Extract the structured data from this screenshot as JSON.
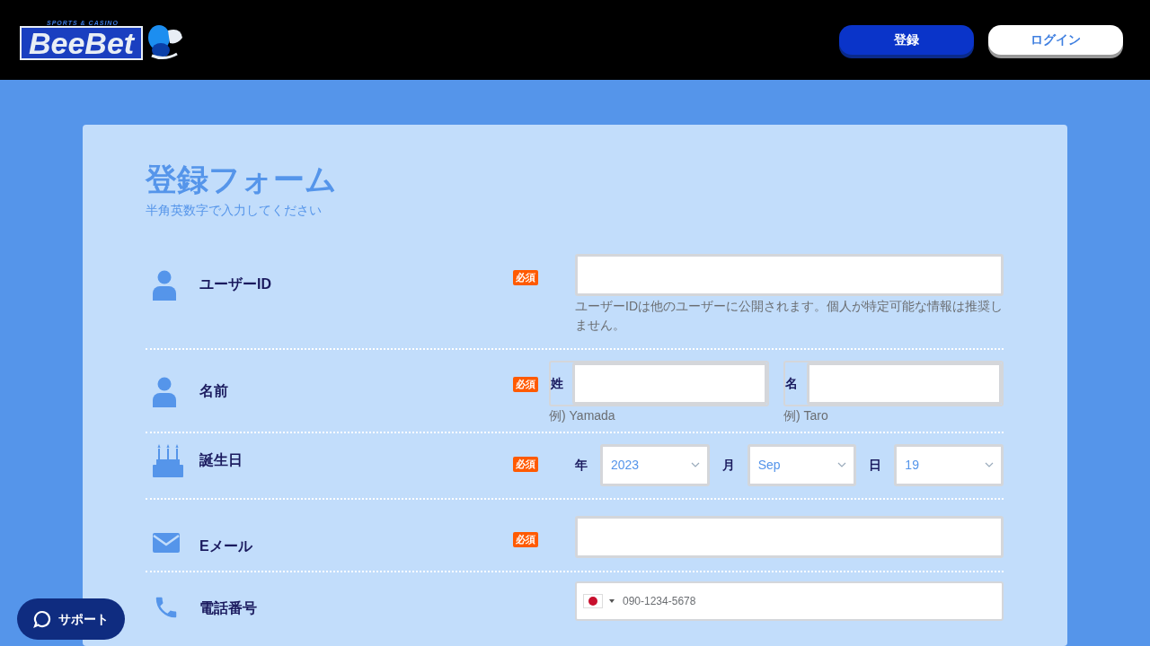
{
  "header": {
    "logo": {
      "tagline": "SPORTS & CASINO",
      "name": "BeeBet"
    },
    "buttons": [
      {
        "label": "登録",
        "kind": "primary"
      },
      {
        "label": "ログイン",
        "kind": "secondary"
      }
    ]
  },
  "form": {
    "title": "登録フォーム",
    "subtitle": "半角英数字で入力してください",
    "rows": [
      {
        "kind": "text",
        "label": "ユーザーID",
        "required": true,
        "required_label": "必須",
        "help": "ユーザーIDは他のユーザーに公開されます。個人が特定可能な情報は推奨しません。"
      },
      {
        "kind": "name",
        "label": "名前",
        "required": true,
        "required_label": "必須",
        "parts": [
          {
            "label": "姓",
            "hint": "例) Yamada"
          },
          {
            "label": "名",
            "hint": "例) Taro"
          }
        ]
      },
      {
        "kind": "date",
        "label": "誕生日",
        "required": true,
        "required_label": "必須",
        "parts": [
          {
            "label": "年",
            "value": "2023"
          },
          {
            "label": "月",
            "value": "Sep"
          },
          {
            "label": "日",
            "value": "19"
          }
        ]
      },
      {
        "kind": "text",
        "label": "Eメール",
        "required": true,
        "required_label": "必須"
      },
      {
        "kind": "phone",
        "label": "電話番号",
        "required": false,
        "placeholder": "090-1234-5678"
      }
    ]
  },
  "support": {
    "label": "サポート"
  }
}
